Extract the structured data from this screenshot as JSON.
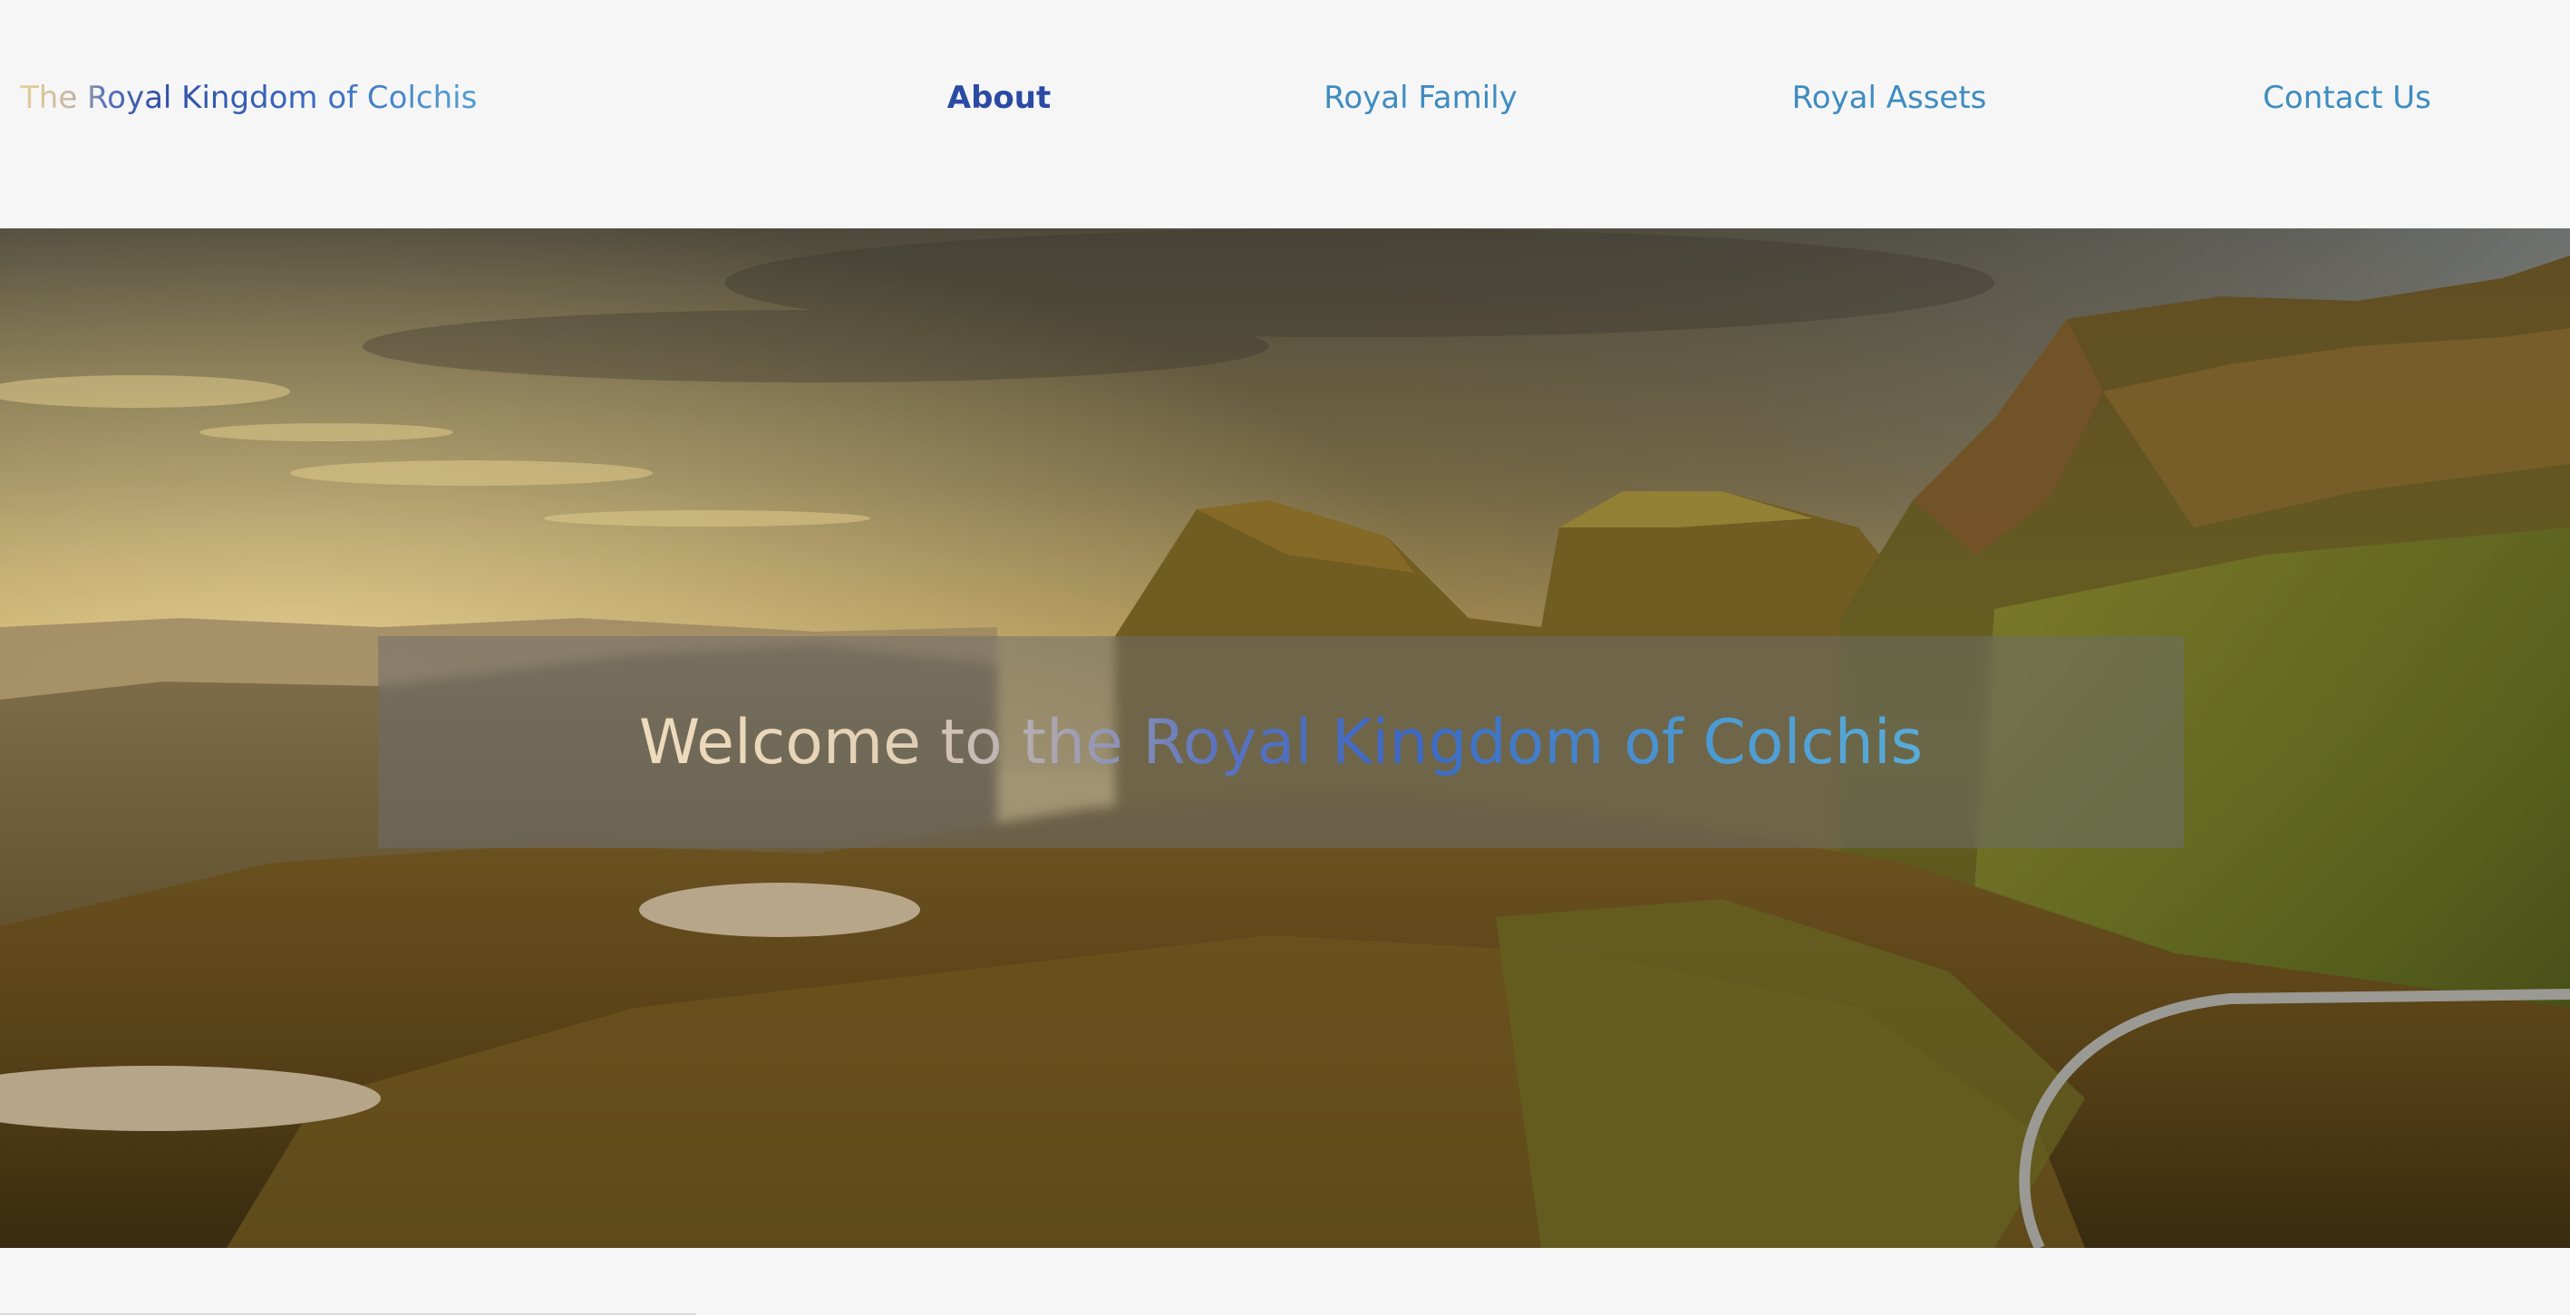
{
  "brand": {
    "title": "The Royal Kingdom of Colchis"
  },
  "nav": {
    "items": [
      {
        "label": "About",
        "active": true
      },
      {
        "label": "Royal Family",
        "active": false
      },
      {
        "label": "Royal Assets",
        "active": false
      },
      {
        "label": "Contact Us",
        "active": false
      }
    ]
  },
  "hero": {
    "heading": "Welcome to the Royal Kingdom of Colchis",
    "image": "mountain-landscape-at-sunset"
  },
  "colors": {
    "background": "#f6f6f6",
    "nav_link": "#3e8cc0",
    "nav_active": "#2a4aa3",
    "brand_start": "#e8cf98",
    "brand_end": "#4f9ad0",
    "overlay": "#6e6e6e"
  }
}
